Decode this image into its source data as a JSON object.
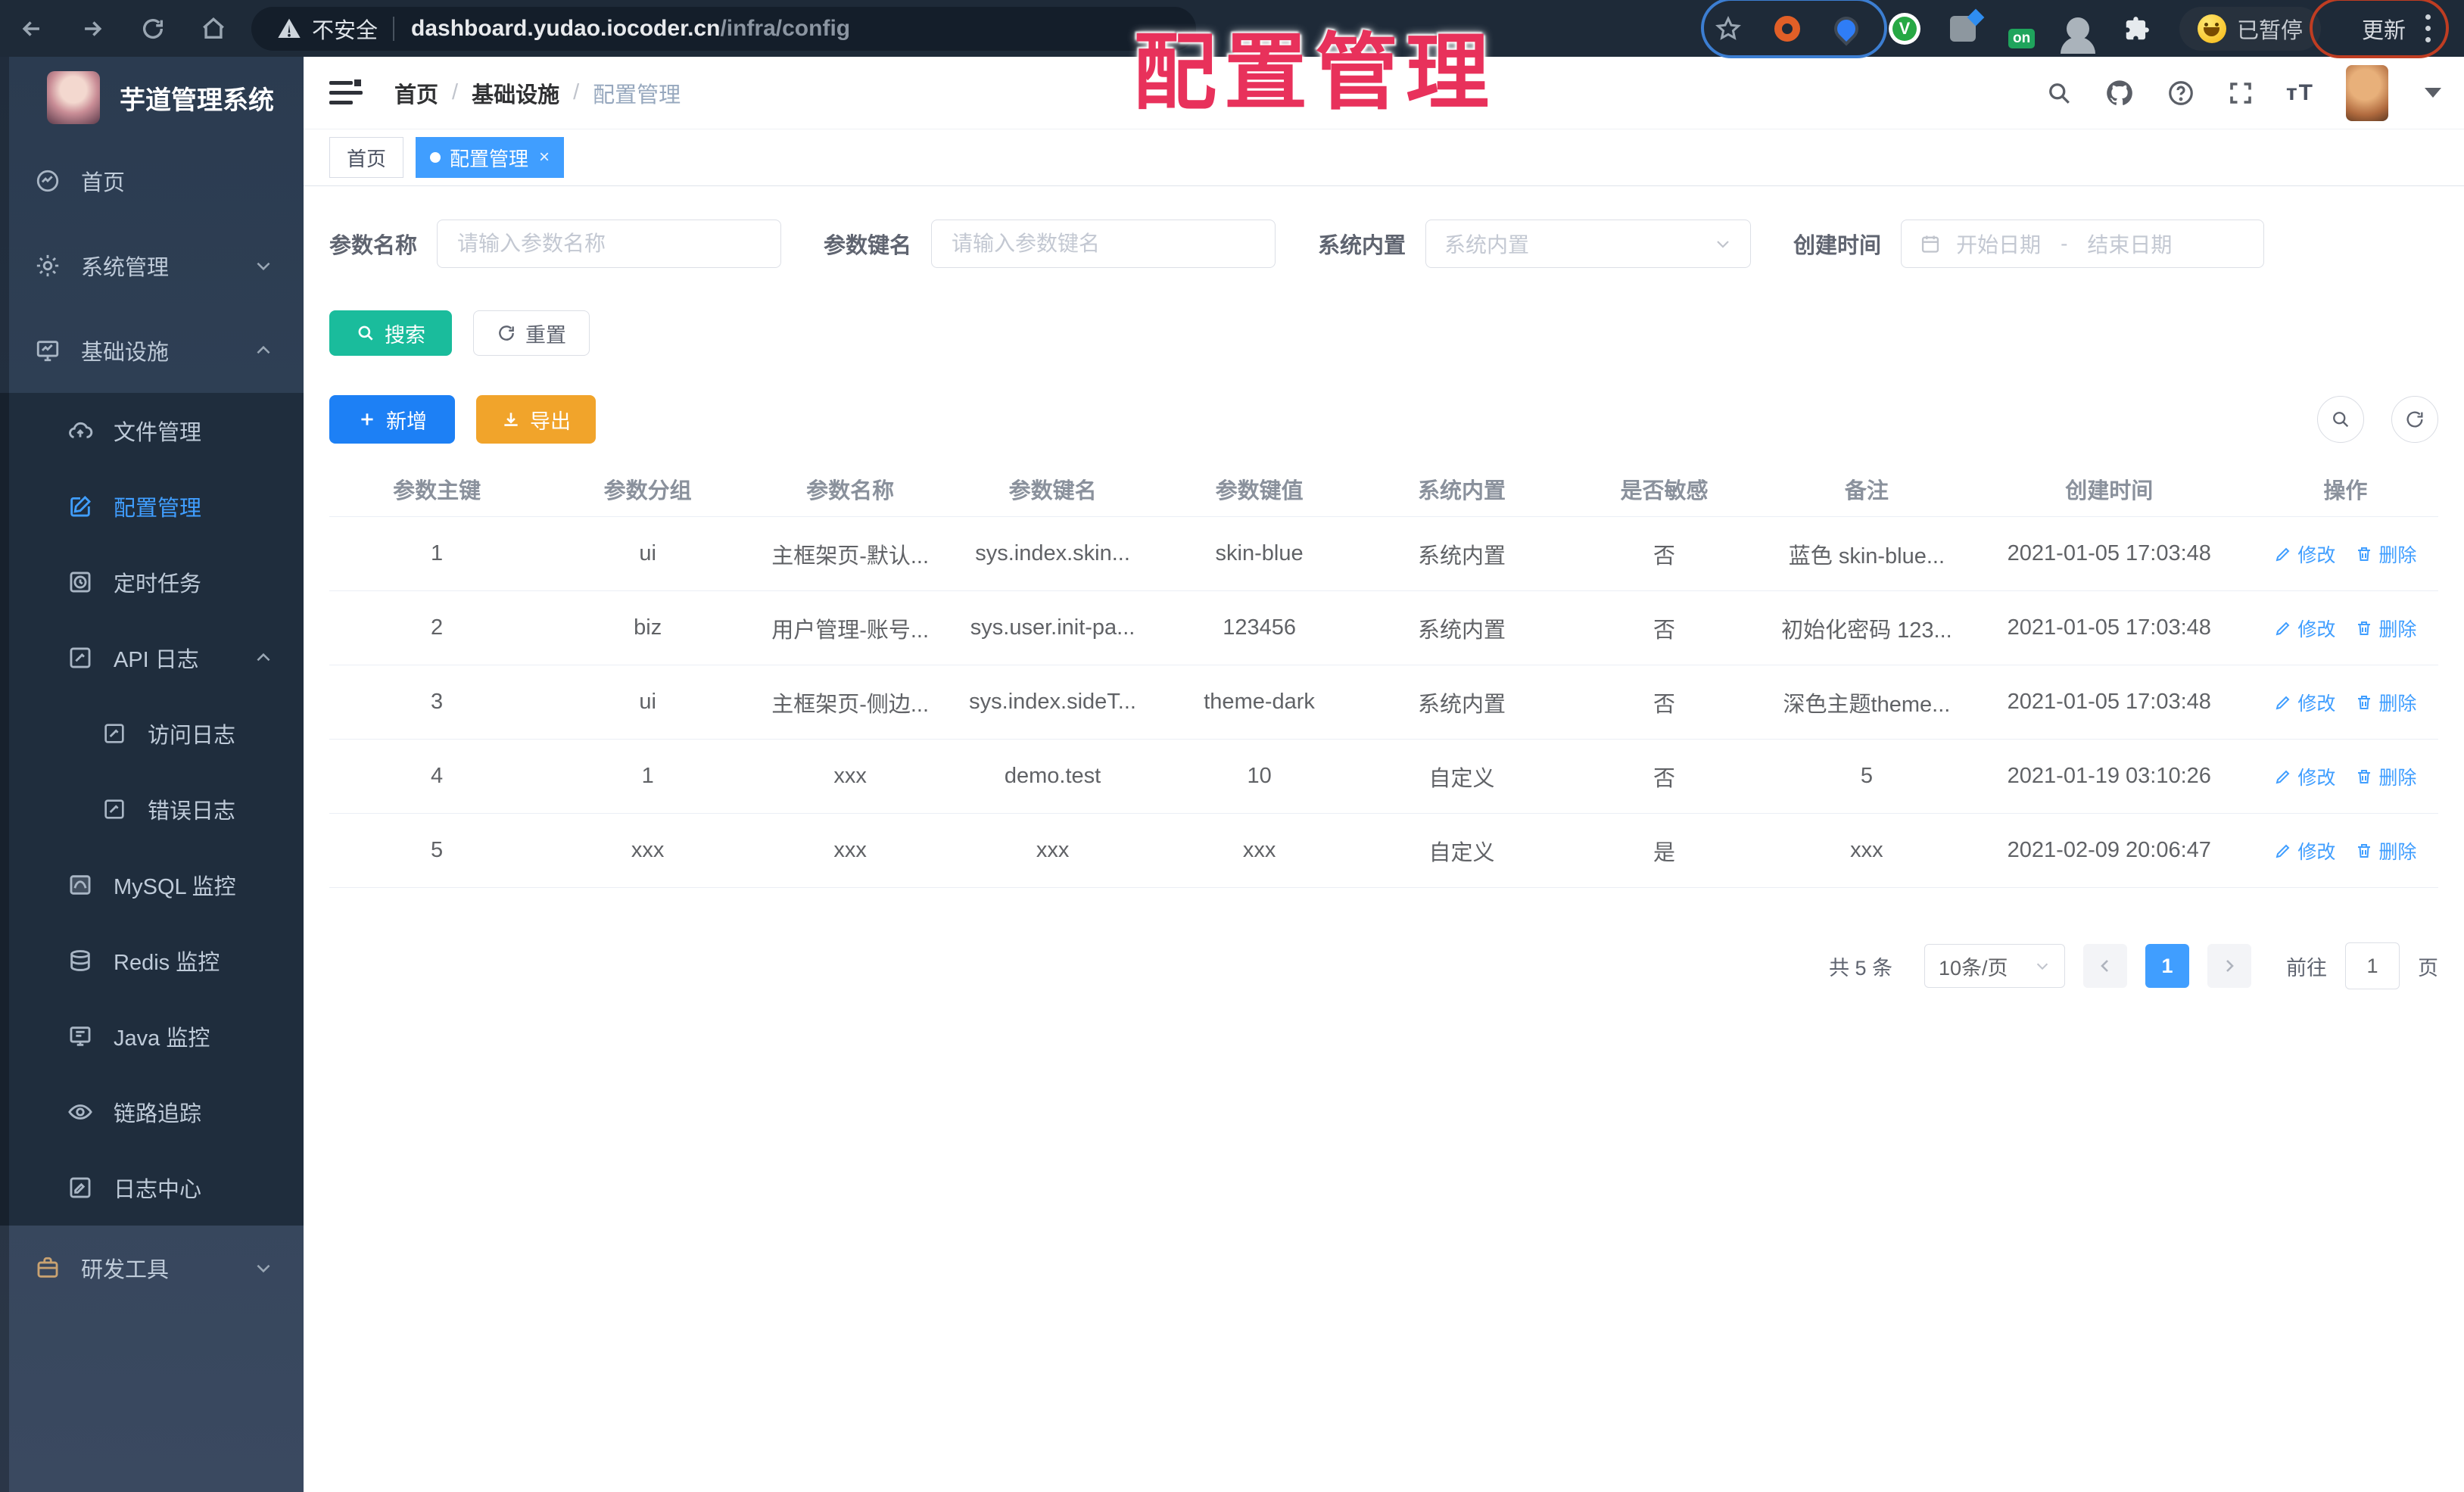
{
  "browser": {
    "security_label": "不安全",
    "url_host": "dashboard.yudao.iocoder.cn",
    "url_path": "/infra/config",
    "ext_on_badge": "on",
    "paused_button": "已暂停",
    "update_button": "更新"
  },
  "overlay": {
    "title": "配置管理",
    "color": "#e8315b"
  },
  "sidebar": {
    "app_title": "芋道管理系统",
    "home": "首页",
    "system": "系统管理",
    "infra": "基础设施",
    "file": "文件管理",
    "config": "配置管理",
    "job": "定时任务",
    "api_log": "API 日志",
    "access_log": "访问日志",
    "error_log": "错误日志",
    "mysql": "MySQL 监控",
    "redis": "Redis 监控",
    "java": "Java 监控",
    "trace": "链路追踪",
    "log_center": "日志中心",
    "dev_tools": "研发工具"
  },
  "header": {
    "bc1": "首页",
    "bc2": "基础设施",
    "bc3": "配置管理"
  },
  "tabs": {
    "home": "首页",
    "active": "配置管理",
    "close": "×"
  },
  "filters": {
    "name_label": "参数名称",
    "name_placeholder": "请输入参数名称",
    "key_label": "参数键名",
    "key_placeholder": "请输入参数键名",
    "type_label": "系统内置",
    "type_placeholder": "系统内置",
    "date_label": "创建时间",
    "date_start": "开始日期",
    "date_sep": "-",
    "date_end": "结束日期"
  },
  "actions": {
    "search": "搜索",
    "reset": "重置",
    "add": "新增",
    "export": "导出"
  },
  "table": {
    "columns": [
      "参数主键",
      "参数分组",
      "参数名称",
      "参数键名",
      "参数键值",
      "系统内置",
      "是否敏感",
      "备注",
      "创建时间",
      "操作"
    ],
    "rows": [
      [
        "1",
        "ui",
        "主框架页-默认...",
        "sys.index.skin...",
        "skin-blue",
        "系统内置",
        "否",
        "蓝色 skin-blue...",
        "2021-01-05 17:03:48"
      ],
      [
        "2",
        "biz",
        "用户管理-账号...",
        "sys.user.init-pa...",
        "123456",
        "系统内置",
        "否",
        "初始化密码 123...",
        "2021-01-05 17:03:48"
      ],
      [
        "3",
        "ui",
        "主框架页-侧边...",
        "sys.index.sideT...",
        "theme-dark",
        "系统内置",
        "否",
        "深色主题theme...",
        "2021-01-05 17:03:48"
      ],
      [
        "4",
        "1",
        "xxx",
        "demo.test",
        "10",
        "自定义",
        "否",
        "5",
        "2021-01-19 03:10:26"
      ],
      [
        "5",
        "xxx",
        "xxx",
        "xxx",
        "xxx",
        "自定义",
        "是",
        "xxx",
        "2021-02-09 20:06:47"
      ]
    ],
    "row_actions": {
      "edit": "修改",
      "delete": "删除"
    }
  },
  "pagination": {
    "total": "共 5 条",
    "page_size": "10条/页",
    "current": "1",
    "goto": "前往",
    "page_value": "1",
    "unit": "页"
  },
  "colors": {
    "accent": "#409eff",
    "search_button": "#1abc9c",
    "add_button": "#1d80f5",
    "export_button": "#f1a42b",
    "sidebar_bg": "#304156",
    "submenu_bg": "#1f2d3d",
    "overlay_red": "#e8315b"
  }
}
